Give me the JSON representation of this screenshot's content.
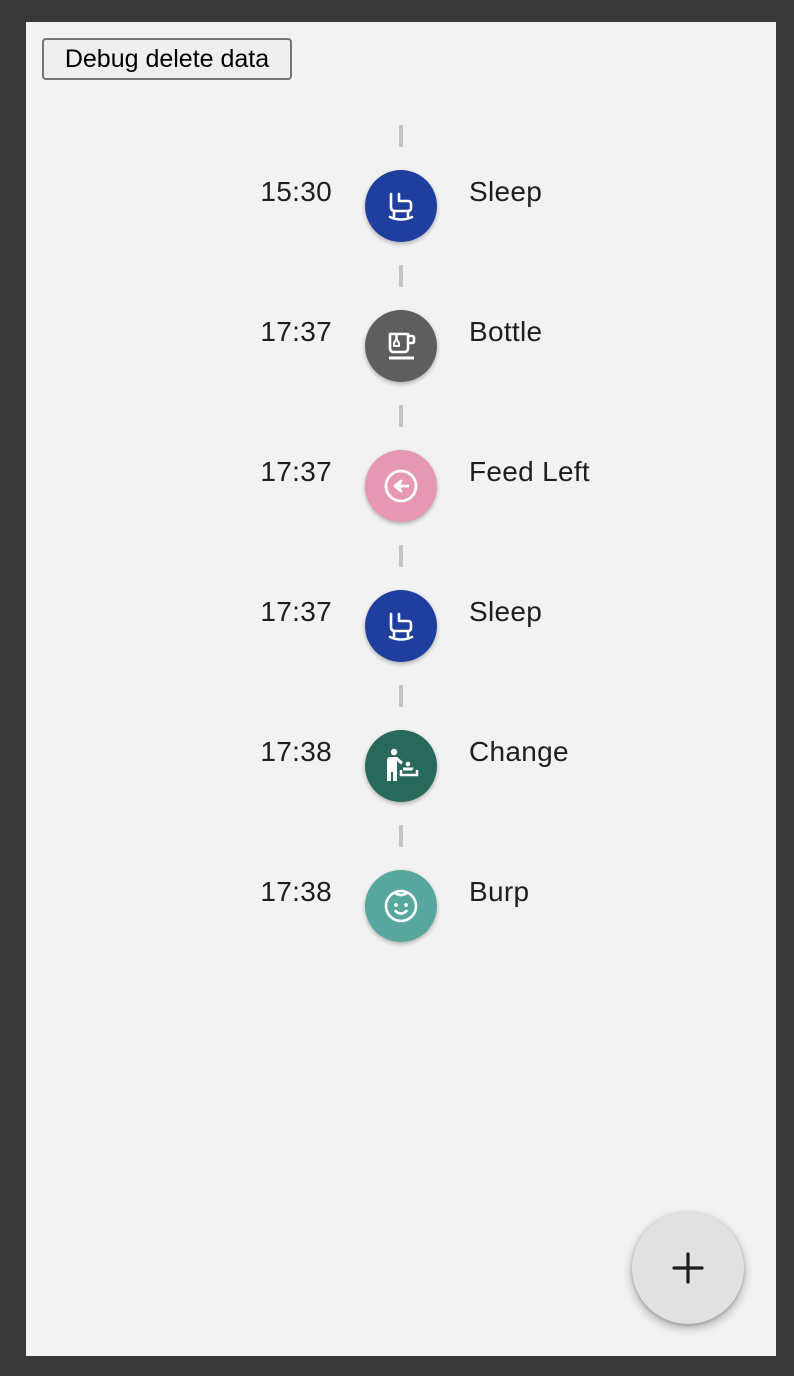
{
  "toolbar": {
    "debug_button_label": "Debug delete data"
  },
  "timeline": {
    "entries": [
      {
        "time": "15:30",
        "label": "Sleep",
        "icon": "rocking-chair-icon",
        "color": "#1f3e9e"
      },
      {
        "time": "17:37",
        "label": "Bottle",
        "icon": "tea-cup-icon",
        "color": "#5e5e5e"
      },
      {
        "time": "17:37",
        "label": "Feed Left",
        "icon": "arrow-left-circle-icon",
        "color": "#e597b3"
      },
      {
        "time": "17:37",
        "label": "Sleep",
        "icon": "rocking-chair-icon",
        "color": "#1f3e9e"
      },
      {
        "time": "17:38",
        "label": "Change",
        "icon": "baby-changing-icon",
        "color": "#27695a"
      },
      {
        "time": "17:38",
        "label": "Burp",
        "icon": "baby-face-icon",
        "color": "#57a79e"
      }
    ]
  },
  "fab": {
    "icon": "plus-icon"
  }
}
